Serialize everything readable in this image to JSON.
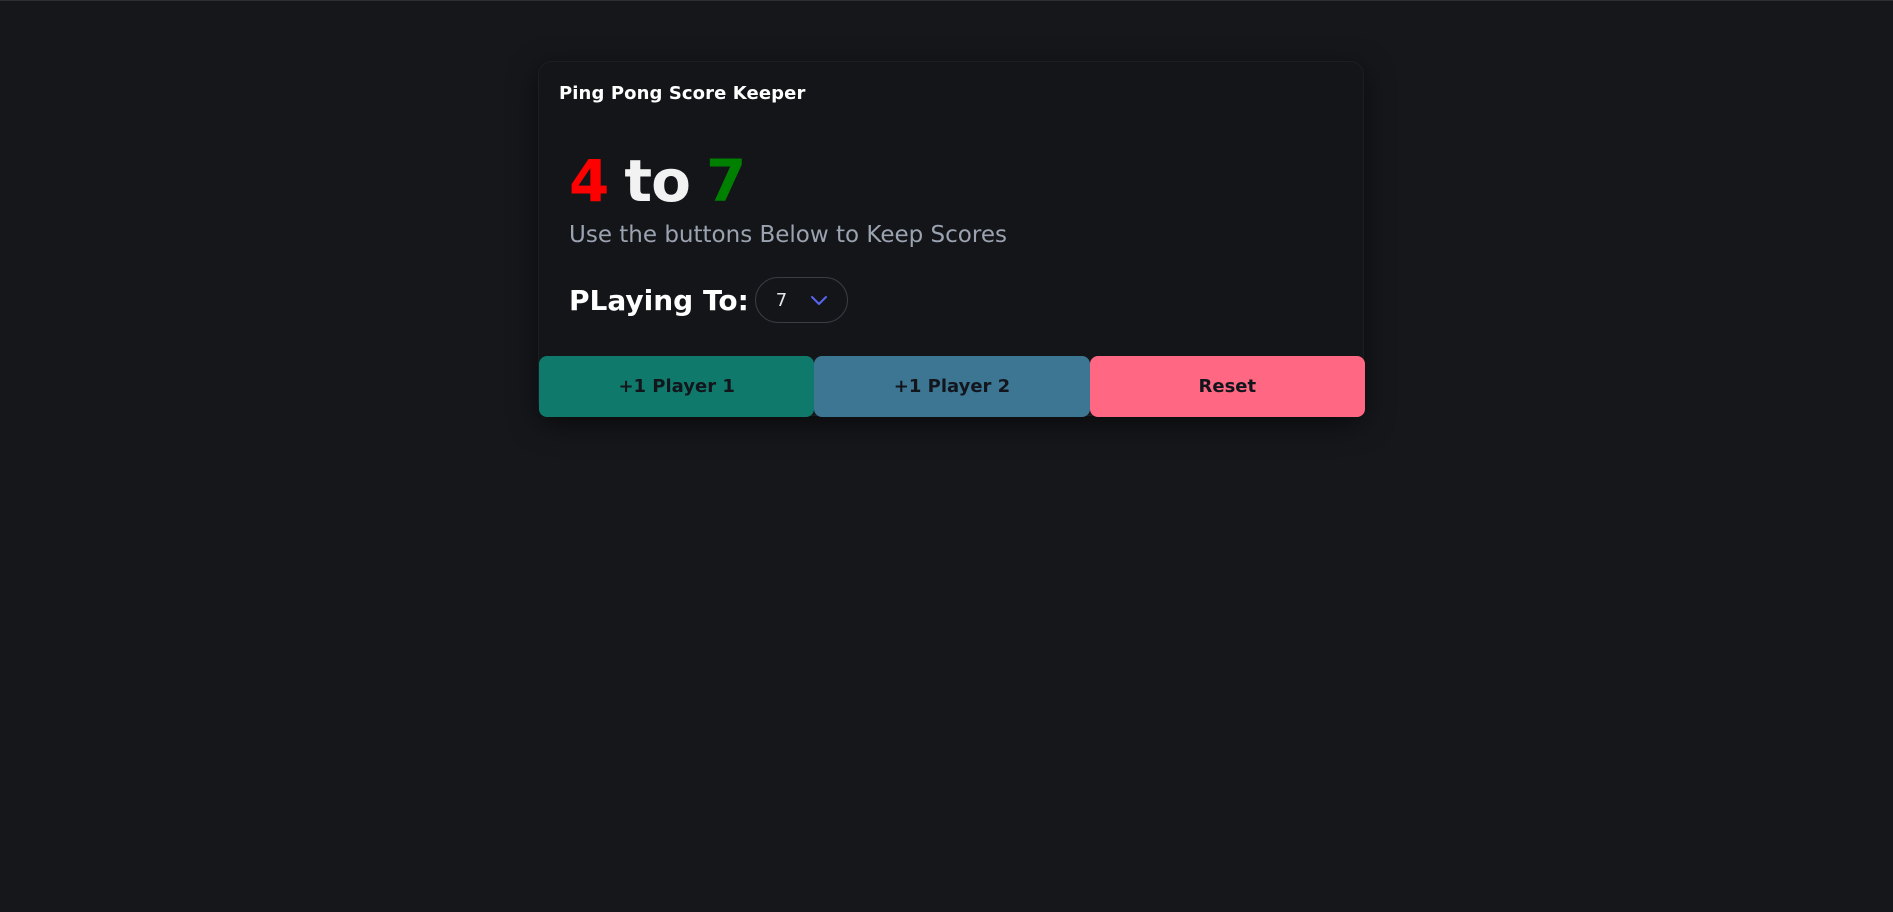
{
  "app": {
    "title": "Ping Pong Score Keeper"
  },
  "score": {
    "player1": "4",
    "separator": "to",
    "player2": "7",
    "player1_color": "#ff0000",
    "player2_color": "#008000"
  },
  "subtitle": "Use the buttons Below to Keep Scores",
  "playing_to": {
    "label": "PLaying To:",
    "selected_value": "7",
    "icon": "chevron-down-icon",
    "icon_color": "#5865f2"
  },
  "buttons": {
    "player1": "+1 Player 1",
    "player2": "+1 Player 2",
    "reset": "Reset",
    "player1_color": "#0f7a6c",
    "player2_color": "#3c7693",
    "reset_color": "#ff6783"
  }
}
